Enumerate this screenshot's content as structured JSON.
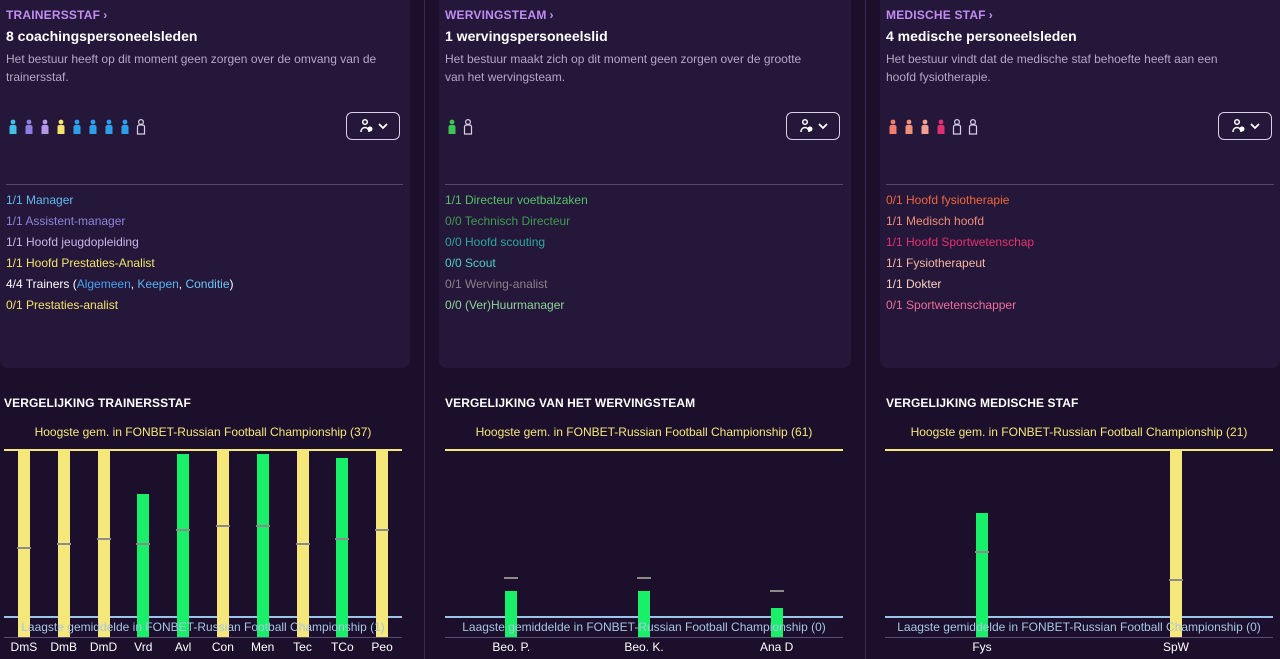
{
  "panels": [
    {
      "header": "TRAINERSSTAF",
      "count": "8 coachingspersoneelsleden",
      "desc_line1": "Het bestuur heeft op dit moment geen zorgen over de omvang van de",
      "desc_line2": "trainersstaf.",
      "people_colors": [
        "#3fc1e8",
        "#8c7fe0",
        "#b696e6",
        "#f4e36c",
        "#2ea0ea",
        "#2ea0ea",
        "#2ea0ea",
        "#2ea0ea"
      ],
      "people_empty": 1,
      "roles": [
        {
          "text": "1/1 Manager",
          "color": "#62b9ee"
        },
        {
          "text": "1/1 Assistent-manager",
          "color": "#8f85da"
        },
        {
          "text": "1/1 Hoofd jeugdopleiding",
          "color": "#c9b6ea"
        },
        {
          "text": "1/1 Hoofd Prestaties-Analist",
          "color": "#f3e46a"
        },
        {
          "text": "0/1 Prestaties-analist",
          "color": "#f3e46a"
        }
      ],
      "trainers": {
        "prefix": "4/4 Trainers (",
        "a": "Algemeen",
        "sep1": ", ",
        "b": "Keepen",
        "sep2": ", ",
        "c": "Conditie",
        "suffix": ")"
      },
      "compare_title": "VERGELIJKING TRAINERSSTAF",
      "highest": "Hoogste gem. in FONBET-Russian Football Championship (37)",
      "lowest": "Laagste gemiddelde in FONBET-Russian Football Championship (1)"
    },
    {
      "header": "WERVINGSTEAM",
      "count": "1 wervingspersoneelslid",
      "desc_line1": "Het bestuur maakt zich op dit moment geen zorgen over de grootte",
      "desc_line2": "van het wervingsteam.",
      "people_colors": [
        "#3ec556"
      ],
      "people_empty": 1,
      "roles": [
        {
          "text": "1/1 Directeur voetbalzaken",
          "color": "#57c06a"
        },
        {
          "text": "0/0 Technisch Directeur",
          "color": "#3f9b4e"
        },
        {
          "text": "0/0 Hoofd scouting",
          "color": "#29a89c"
        },
        {
          "text": "0/0 Scout",
          "color": "#4fcfc2"
        },
        {
          "text": "0/1 Werving-analist",
          "color": "#8c8088"
        },
        {
          "text": "0/0 (Ver)Huurmanager",
          "color": "#8fd59a"
        }
      ],
      "compare_title": "VERGELIJKING VAN HET WERVINGSTEAM",
      "highest": "Hoogste gem. in FONBET-Russian Football Championship (61)",
      "lowest": "Laagste gemiddelde in FONBET-Russian Football Championship (0)"
    },
    {
      "header": "MEDISCHE STAF",
      "count": "4 medische personeelsleden",
      "desc_line1": "Het bestuur vindt dat de medische staf behoefte heeft aan een",
      "desc_line2": "hoofd fysiotherapie.",
      "people_colors": [
        "#f27d6c",
        "#f28f7a",
        "#f2a092",
        "#e03074"
      ],
      "people_empty": 2,
      "roles": [
        {
          "text": "0/1 Hoofd fysiotherapie",
          "color": "#f0673c"
        },
        {
          "text": "1/1 Medisch hoofd",
          "color": "#f28d79"
        },
        {
          "text": "1/1 Hoofd Sportwetenschap",
          "color": "#e9306e"
        },
        {
          "text": "1/1 Fysiotherapeut",
          "color": "#f6b59e"
        },
        {
          "text": "1/1 Dokter",
          "color": "#f9cfc0"
        },
        {
          "text": "0/1 Sportwetenschapper",
          "color": "#ee6d9b"
        }
      ],
      "compare_title": "VERGELIJKING MEDISCHE STAF",
      "highest": "Hoogste gem. in FONBET-Russian Football Championship (21)",
      "lowest": "Laagste gemiddelde in FONBET-Russian Football Championship (0)"
    }
  ],
  "colors": {
    "trainers_a": "#4aa3f0",
    "trainers_b": "#5ab4f2",
    "trainers_c": "#6bc6f2",
    "good": "#18f06a",
    "warn": "#f6e77a",
    "avg": "#8d8a8a"
  },
  "chart_data": [
    {
      "type": "bar",
      "title": "VERGELIJKING TRAINERSSTAF",
      "categories": [
        "DmS",
        "DmB",
        "DmD",
        "Vrd",
        "Avl",
        "Con",
        "Men",
        "Tec",
        "TCo",
        "Peo"
      ],
      "ylim": [
        0,
        37
      ],
      "series": [
        {
          "values": [
            37,
            37,
            37,
            27,
            36,
            37,
            36,
            37,
            35,
            37
          ],
          "colors": [
            "warn",
            "warn",
            "warn",
            "good",
            "good",
            "warn",
            "good",
            "warn",
            "good",
            "warn"
          ]
        },
        {
          "values": [
            15,
            16,
            17,
            16,
            19,
            20,
            20,
            16,
            17,
            19
          ]
        }
      ]
    },
    {
      "type": "bar",
      "title": "VERGELIJKING VAN HET WERVINGSTEAM",
      "categories": [
        "Beo. P.",
        "Beo. K.",
        "Ana D"
      ],
      "ylim": [
        0,
        61
      ],
      "series": [
        {
          "values": [
            9,
            9,
            3
          ],
          "colors": [
            "good",
            "good",
            "good"
          ]
        },
        {
          "values": [
            14,
            14,
            9
          ]
        }
      ]
    },
    {
      "type": "bar",
      "title": "VERGELIJKING MEDISCHE STAF",
      "categories": [
        "Fys",
        "SpW"
      ],
      "ylim": [
        0,
        21
      ],
      "series": [
        {
          "values": [
            13,
            21
          ],
          "colors": [
            "good",
            "warn"
          ]
        },
        {
          "values": [
            8,
            4.5
          ]
        }
      ]
    }
  ]
}
